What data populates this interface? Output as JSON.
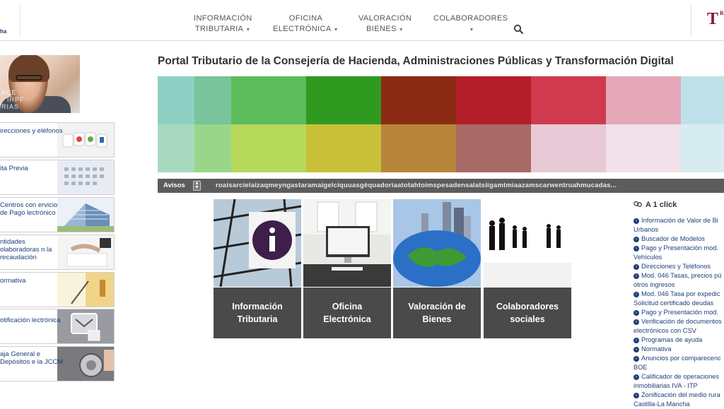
{
  "header": {
    "logo_left_text": "ha",
    "logo_right_text": "T",
    "logo_right_small": "R",
    "nav": [
      {
        "line1": "INFORMACIÓN",
        "line2": "TRIBUTARIA"
      },
      {
        "line1": "OFICINA",
        "line2": "ELECTRÓNICA"
      },
      {
        "line1": "VALORACIÓN",
        "line2": "BIENES"
      },
      {
        "line1": "COLABORADORES",
        "line2": ""
      }
    ]
  },
  "sidebar": {
    "promo_text_1": "ACE",
    "promo_text_2": "IRPF",
    "promo_text_3": "RIAS",
    "items": [
      {
        "label": "irecciones y eléfonos"
      },
      {
        "label": "ita Previa"
      },
      {
        "label": "Centros con ervicio de Pago lectrónico"
      },
      {
        "label": "ntidades olaboradoras n la recaudación"
      },
      {
        "label": "ormativa"
      },
      {
        "label": "otificación lectrónica"
      },
      {
        "label": "aja General e Depósitos e la JCCM"
      }
    ]
  },
  "main": {
    "title": "Portal Tributario de la Consejería de Hacienda, Administraciones Públicas y Transformación Digital",
    "avisos_label": "Avisos",
    "ticker_text": "roaisarcielaizaqmeyngastaramaigelciquuasgéquadoriaatotahtoimspesadensalatsiigamtmiaazamscarwentruahmucadas...",
    "tiles": [
      {
        "caption_1": "Información",
        "caption_2": "Tributaria"
      },
      {
        "caption_1": "Oficina",
        "caption_2": "Electrónica"
      },
      {
        "caption_1": "Valoración de",
        "caption_2": "Bienes"
      },
      {
        "caption_1": "Colaboradores",
        "caption_2": "sociales"
      }
    ]
  },
  "a1click": {
    "title": "A 1 click",
    "links": [
      {
        "text": "Información de Valor de Bi"
      },
      {
        "text": "Urbanos",
        "cont": true
      },
      {
        "text": "Buscador de Modelos"
      },
      {
        "text": "Pago y Presentación mod."
      },
      {
        "text": "Vehículos",
        "cont": true
      },
      {
        "text": "Direcciones y Teléfonos"
      },
      {
        "text": "Mod. 046 Tasas, precios pú"
      },
      {
        "text": "otros ingresos",
        "cont": true
      },
      {
        "text": "Mod. 046 Tasa por expedic"
      },
      {
        "text": "Solicitud certificado deudas",
        "cont": true
      },
      {
        "text": "Pago y Presentación mod."
      },
      {
        "text": "Verificación de documentos"
      },
      {
        "text": "electrónicos con CSV",
        "cont": true
      },
      {
        "text": "Programas de ayuda"
      },
      {
        "text": "Normativa"
      },
      {
        "text": "Anuncios por comparecenc"
      },
      {
        "text": "BOE",
        "cont": true
      },
      {
        "text": "Calificador de operaciones"
      },
      {
        "text": "inmobiliarias IVA - ITP",
        "cont": true
      },
      {
        "text": "Zonificación del medio rura"
      },
      {
        "text": "Castilla-La Mancha",
        "cont": true
      }
    ]
  },
  "colors": {
    "link_blue": "#1d3f7a",
    "caption_bg": "#4a4a4a",
    "avisos_bg": "#5c5c5c",
    "brand_red": "#8a1a2b"
  },
  "icons": {
    "search": "search-icon",
    "link": "link-icon",
    "arrow": "arrow-right-circle-icon"
  }
}
